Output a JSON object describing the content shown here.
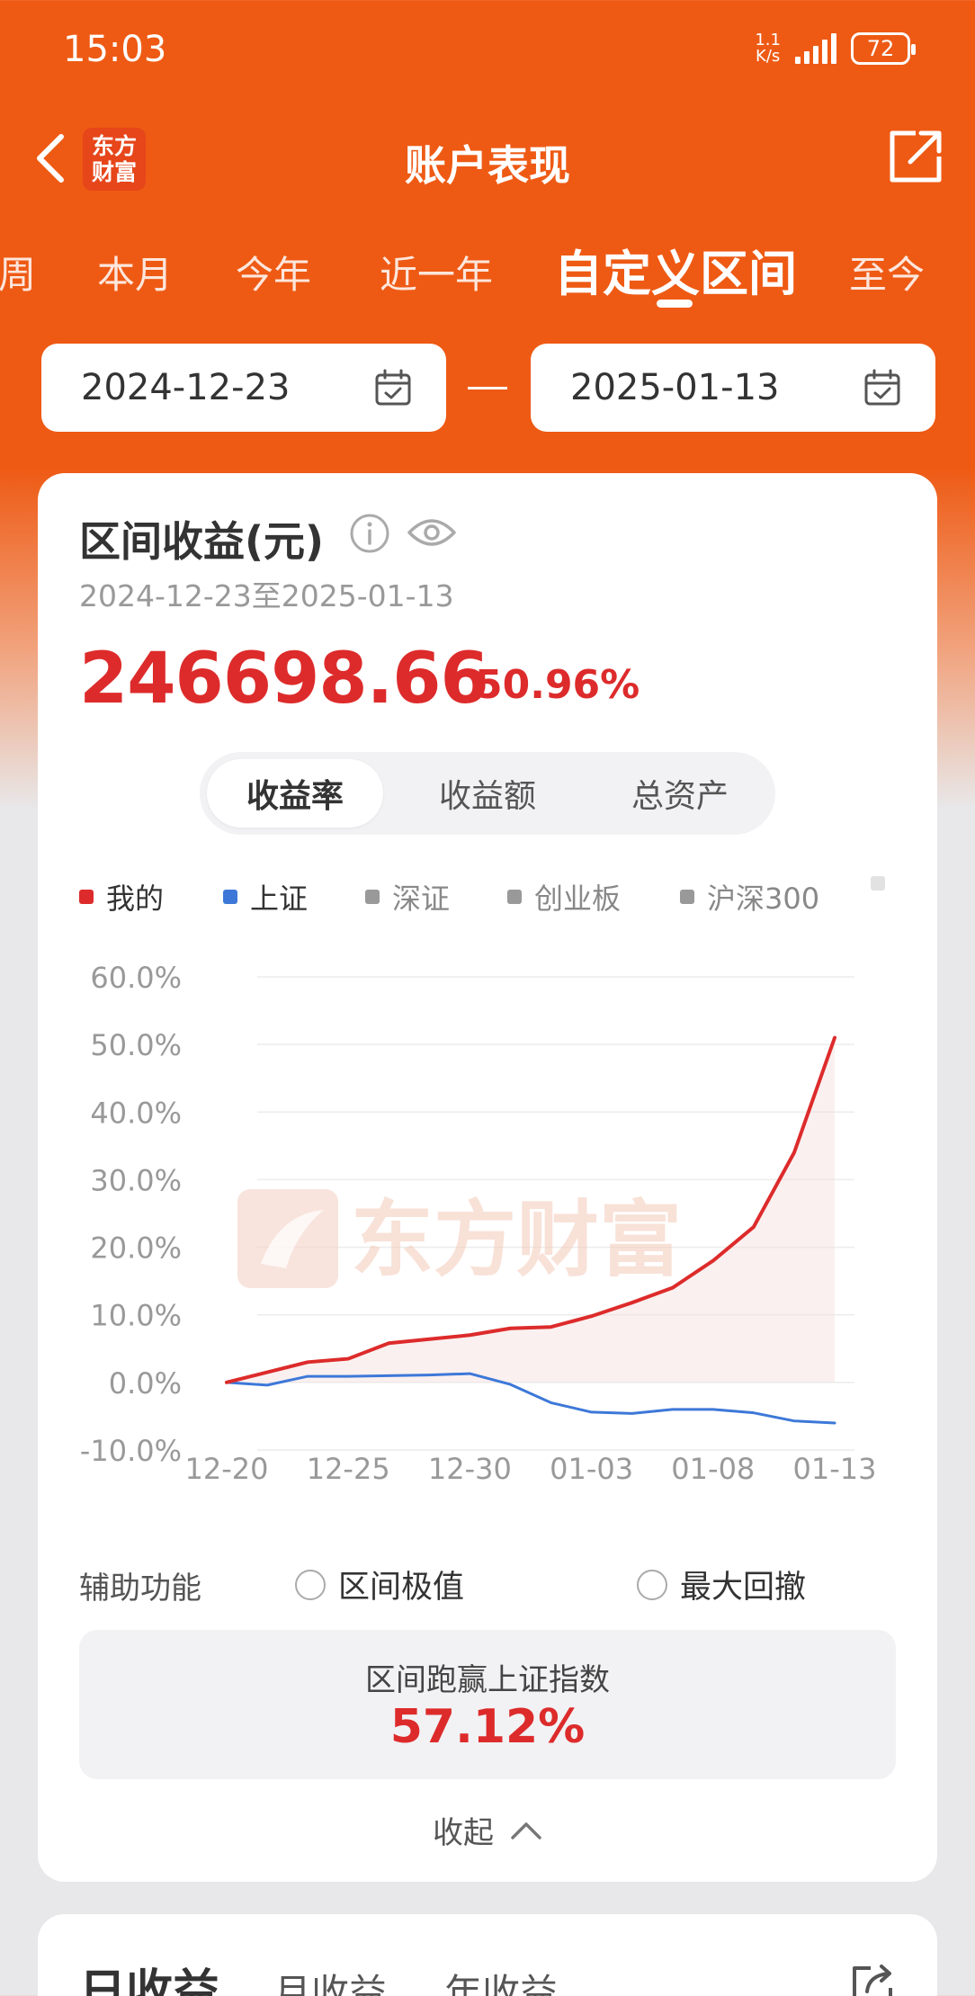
{
  "status_bar": {
    "time": "15:03",
    "net_speed_value": "1.1",
    "net_speed_unit": "K/s",
    "battery": "72"
  },
  "header": {
    "title": "账户表现",
    "logo_line1": "东方",
    "logo_line2": "财富",
    "back_icon": "chevron-left-icon",
    "share_icon": "share-external-icon"
  },
  "tabs": [
    {
      "label": "周"
    },
    {
      "label": "本月"
    },
    {
      "label": "今年"
    },
    {
      "label": "近一年"
    },
    {
      "label": "自定义区间",
      "active": true
    },
    {
      "label": "至今"
    }
  ],
  "date_range": {
    "start": "2024-12-23",
    "end": "2025-01-13",
    "calendar_icon": "calendar-check-icon"
  },
  "summary": {
    "title": "区间收益(元)",
    "range_text": "2024-12-23至2025-01-13",
    "profit_value": "246698.66",
    "profit_rate": "50.96%"
  },
  "segment": {
    "items": [
      "收益率",
      "收益额",
      "总资产"
    ],
    "selected": "收益率"
  },
  "legend": [
    {
      "name": "我的",
      "color": "#dd2b2b",
      "active": true
    },
    {
      "name": "上证",
      "color": "#3d78d8",
      "active": true
    },
    {
      "name": "深证",
      "color": "#999999",
      "active": false
    },
    {
      "name": "创业板",
      "color": "#999999",
      "active": false
    },
    {
      "name": "沪深300",
      "color": "#999999",
      "active": false
    }
  ],
  "chart_data": {
    "type": "line",
    "x_ticks": [
      "12-20",
      "12-25",
      "12-30",
      "01-03",
      "01-08",
      "01-13"
    ],
    "y_ticks": [
      "60.0%",
      "50.0%",
      "40.0%",
      "30.0%",
      "20.0%",
      "10.0%",
      "0.0%",
      "-10.0%"
    ],
    "ylim": [
      -10,
      60
    ],
    "watermark": "东方财富",
    "series": [
      {
        "name": "我的",
        "color": "#dd2b2b",
        "values": [
          0,
          1.5,
          3.0,
          3.5,
          5.8,
          6.4,
          7.0,
          8.0,
          8.2,
          9.8,
          11.8,
          14.0,
          18.0,
          23.0,
          34.0,
          51.0
        ]
      },
      {
        "name": "上证",
        "color": "#3d78d8",
        "values": [
          0,
          -0.4,
          0.9,
          0.9,
          1.0,
          1.1,
          1.3,
          -0.3,
          -3.0,
          -4.4,
          -4.6,
          -4.0,
          -4.0,
          -4.5,
          -5.7,
          -6.0
        ]
      }
    ]
  },
  "aux": {
    "label": "辅助功能",
    "option1": "区间极值",
    "option2": "最大回撤"
  },
  "beat": {
    "label": "区间跑赢上证指数",
    "value": "57.12%"
  },
  "collapse_label": "收起",
  "bottom_tabs": {
    "items": [
      "日收益",
      "月收益",
      "年收益"
    ],
    "selected": "日收益"
  }
}
